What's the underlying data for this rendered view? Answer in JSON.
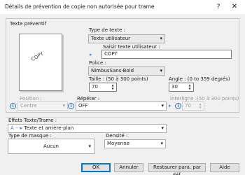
{
  "window": {
    "title": "Détails de prévention de copie non autorisée pour trame",
    "help_icon": "?",
    "close_icon": "✕"
  },
  "group": {
    "label": "Texte préventif",
    "preview_text": "COPY"
  },
  "text_type": {
    "label": "Type de texte :",
    "value": "Texte utilisateur"
  },
  "user_text": {
    "label": "Saisir texte utilisateur :",
    "value": "COPY"
  },
  "font": {
    "label": "Police :",
    "value": "NimbusSans-Bold"
  },
  "size": {
    "label": "Taille : (50 à 300 points)",
    "value": "70"
  },
  "angle": {
    "label": "Angle : (0 to 359 degrés)",
    "value": "30"
  },
  "position": {
    "label": "Position :",
    "value": "Centre"
  },
  "repeat": {
    "label": "Répéter :",
    "value": "OFF"
  },
  "line_spacing": {
    "label": "Interligne :(50 à 300 points)",
    "value": "70"
  },
  "text_effects": {
    "label": "Effets Texte/Trame :",
    "value": "Texte et arrière-plan",
    "prefix": "A ···▸"
  },
  "mask_type": {
    "label": "Type de masque :",
    "value": "Aucun"
  },
  "density": {
    "label": "Densité :",
    "value": "Moyenne"
  },
  "buttons": {
    "ok": "OK",
    "cancel": "Annuler",
    "restore": "Restaurer para. par déf.",
    "help": "Aide"
  },
  "icons": {
    "info": "i",
    "arrow": "▸",
    "dropdown": "▾"
  }
}
